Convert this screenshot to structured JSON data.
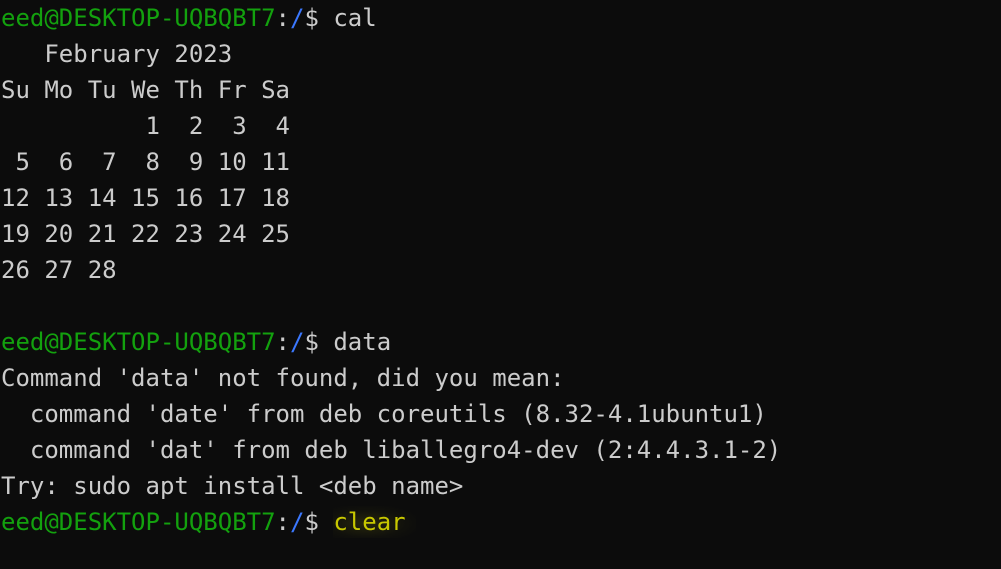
{
  "colors": {
    "background": "#0c0c0c",
    "foreground": "#cccccc",
    "user_host": "#13a10e",
    "path": "#3b78ff",
    "autosuggest": "#c8c800"
  },
  "prompt": {
    "user_host": "eed@DESKTOP-UQBQBT7",
    "colon": ":",
    "path": "/",
    "symbol": "$ "
  },
  "session": {
    "cmd1": "cal",
    "cal_title": "   February 2023",
    "cal_header": "Su Mo Tu We Th Fr Sa",
    "cal_weeks": [
      "          1  2  3  4",
      " 5  6  7  8  9 10 11",
      "12 13 14 15 16 17 18",
      "19 20 21 22 23 24 25",
      "26 27 28"
    ],
    "cmd2": "data",
    "error_line": "Command 'data' not found, did you mean:",
    "suggestions": [
      "  command 'date' from deb coreutils (8.32-4.1ubuntu1)",
      "  command 'dat' from deb liballegro4-dev (2:4.4.3.1-2)"
    ],
    "try_line": "Try: sudo apt install <deb name>",
    "cmd3": "clear"
  }
}
